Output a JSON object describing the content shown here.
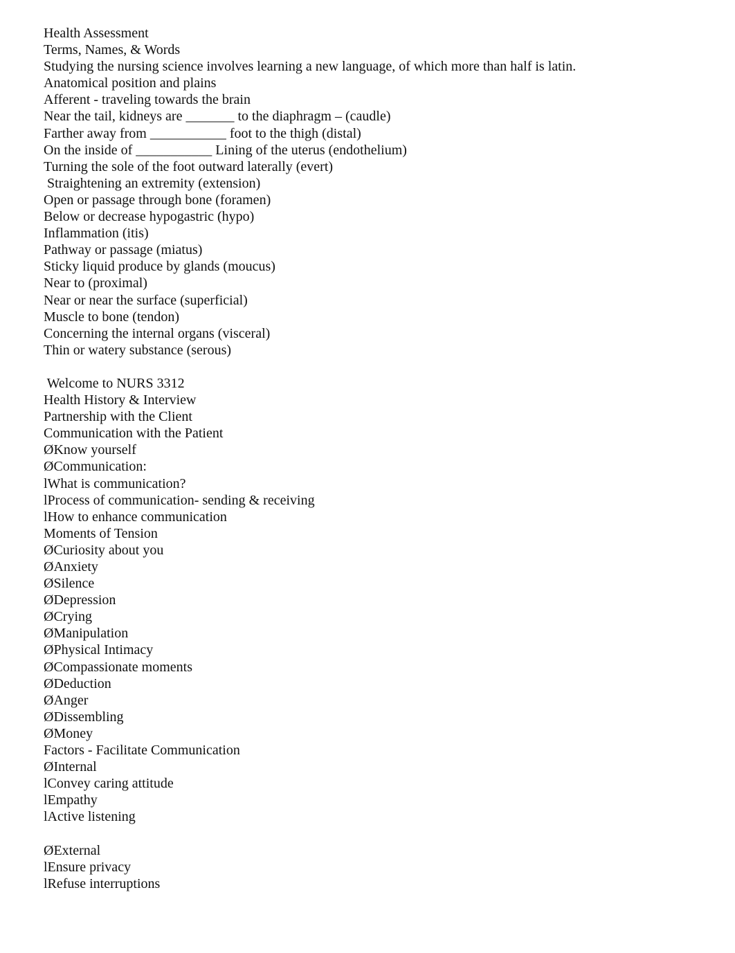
{
  "document": {
    "title": "Health Assessment",
    "section1": [
      "Health Assessment",
      "Terms, Names, & Words",
      "Studying the nursing science involves learning a new language, of which more than half is latin.",
      "Anatomical position and plains",
      "Afferent - traveling towards the brain",
      "Near the tail, kidneys are _______ to the diaphragm – (caudle)",
      "Farther away from ___________ foot to the thigh (distal)",
      "On the inside of ___________ Lining of the uterus (endothelium)",
      "Turning the sole of the foot outward laterally (evert)",
      " Straightening an extremity (extension)",
      "Open or passage through bone (foramen)",
      "Below or decrease hypogastric (hypo)",
      "Inflammation (itis)",
      "Pathway or passage (miatus)",
      "Sticky liquid produce by glands (moucus)",
      "Near to (proximal)",
      "Near or near the surface (superficial)",
      "Muscle to bone (tendon)",
      "Concerning the internal organs (visceral)",
      "Thin or watery substance (serous)"
    ],
    "section2": [
      " Welcome to NURS 3312",
      "Health History & Interview",
      "Partnership with the Client",
      "Communication with the Patient",
      "ØKnow yourself",
      "ØCommunication:",
      "lWhat is communication?",
      "lProcess of communication- sending & receiving",
      "lHow to enhance communication",
      "Moments of Tension",
      "ØCuriosity about you",
      "ØAnxiety",
      "ØSilence",
      "ØDepression",
      "ØCrying",
      "ØManipulation",
      "ØPhysical Intimacy",
      "ØCompassionate moments",
      "ØDeduction",
      "ØAnger",
      "ØDissembling",
      "ØMoney",
      "Factors - Facilitate Communication",
      "ØInternal",
      "lConvey caring attitude",
      "lEmpathy",
      "lActive listening"
    ],
    "section3": [
      "ØExternal",
      "lEnsure privacy",
      "lRefuse interruptions"
    ]
  }
}
